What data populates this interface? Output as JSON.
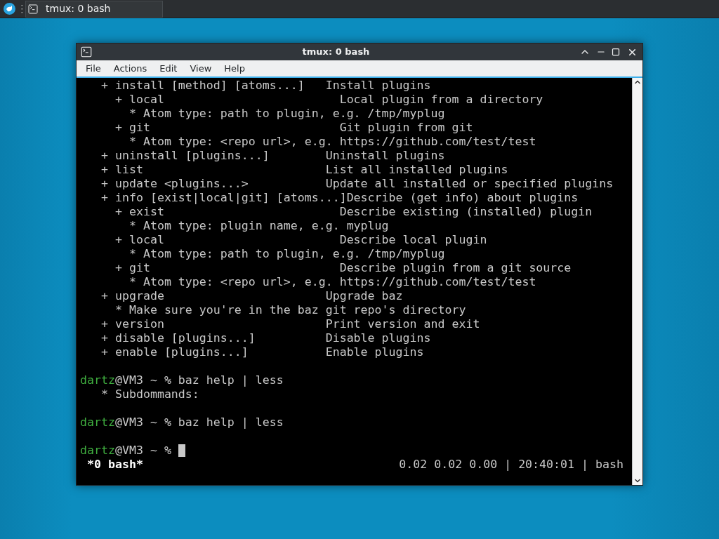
{
  "taskbar": {
    "task": {
      "title": "tmux: 0 bash"
    }
  },
  "window": {
    "title": "tmux: 0 bash",
    "menu": [
      "File",
      "Actions",
      "Edit",
      "View",
      "Help"
    ],
    "terminal": {
      "lines": [
        {
          "kind": "output",
          "text": "   + install [method] [atoms...]   Install plugins"
        },
        {
          "kind": "output",
          "text": "     + local                         Local plugin from a directory"
        },
        {
          "kind": "output",
          "text": "       * Atom type: path to plugin, e.g. /tmp/myplug"
        },
        {
          "kind": "output",
          "text": "     + git                           Git plugin from git"
        },
        {
          "kind": "output",
          "text": "       * Atom type: <repo url>, e.g. https://github.com/test/test"
        },
        {
          "kind": "output",
          "text": "   + uninstall [plugins...]        Uninstall plugins"
        },
        {
          "kind": "output",
          "text": "   + list                          List all installed plugins"
        },
        {
          "kind": "output",
          "text": "   + update <plugins...>           Update all installed or specified plugins"
        },
        {
          "kind": "output",
          "text": "   + info [exist|local|git] [atoms...]Describe (get info) about plugins"
        },
        {
          "kind": "output",
          "text": "     + exist                         Describe existing (installed) plugin"
        },
        {
          "kind": "output",
          "text": "       * Atom type: plugin name, e.g. myplug"
        },
        {
          "kind": "output",
          "text": "     + local                         Describe local plugin"
        },
        {
          "kind": "output",
          "text": "       * Atom type: path to plugin, e.g. /tmp/myplug"
        },
        {
          "kind": "output",
          "text": "     + git                           Describe plugin from a git source"
        },
        {
          "kind": "output",
          "text": "       * Atom type: <repo url>, e.g. https://github.com/test/test"
        },
        {
          "kind": "output",
          "text": "   + upgrade                       Upgrade baz"
        },
        {
          "kind": "output",
          "text": "     * Make sure you're in the baz git repo's directory"
        },
        {
          "kind": "output",
          "text": "   + version                       Print version and exit"
        },
        {
          "kind": "output",
          "text": "   + disable [plugins...]          Disable plugins"
        },
        {
          "kind": "output",
          "text": "   + enable [plugins...]           Enable plugins"
        },
        {
          "kind": "blank"
        },
        {
          "kind": "prompt",
          "user": "dartz",
          "text": "@VM3 ~ % baz help | less",
          "cursor": false
        },
        {
          "kind": "output",
          "text": "   * Subdommands:"
        },
        {
          "kind": "blank"
        },
        {
          "kind": "prompt",
          "user": "dartz",
          "text": "@VM3 ~ % baz help | less",
          "cursor": false
        },
        {
          "kind": "blank"
        },
        {
          "kind": "prompt",
          "user": "dartz",
          "text": "@VM3 ~ % ",
          "cursor": true
        }
      ],
      "status_bar": {
        "left": " *0 bash*",
        "right": "0.02 0.02 0.00 | 20:40:01 | bash"
      }
    }
  }
}
